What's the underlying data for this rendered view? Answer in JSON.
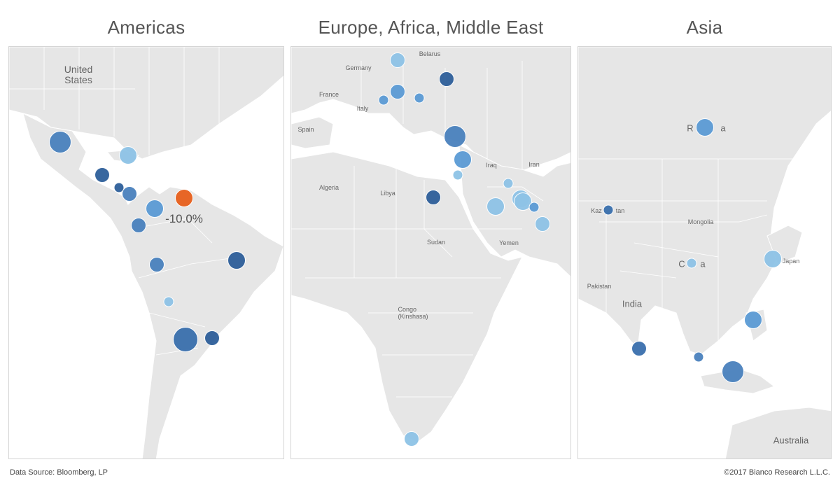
{
  "panels": [
    {
      "id": "americas",
      "title": "Americas",
      "labels": [
        {
          "text": "United\nStates",
          "style": "big"
        }
      ],
      "bubbles": [
        {
          "color": "#4a81bd",
          "size": "large"
        },
        {
          "color": "#8ec3e6",
          "size": "medium"
        },
        {
          "color": "#2e5f9a",
          "size": "small"
        },
        {
          "color": "#2e5f9a",
          "size": "tiny"
        },
        {
          "color": "#4a81bd",
          "size": "small"
        },
        {
          "color": "#e8601c",
          "size": "medium",
          "value_label": "-10.0%"
        },
        {
          "color": "#5b9bd5",
          "size": "medium"
        },
        {
          "color": "#4a81bd",
          "size": "small"
        },
        {
          "color": "#2e5f9a",
          "size": "medium"
        },
        {
          "color": "#4a81bd",
          "size": "small"
        },
        {
          "color": "#8ec3e6",
          "size": "tiny"
        },
        {
          "color": "#3a6fad",
          "size": "xlarge"
        },
        {
          "color": "#2e5f9a",
          "size": "small"
        }
      ]
    },
    {
      "id": "emea",
      "title": "Europe, Africa, Middle East",
      "labels": [
        {
          "text": "Belarus"
        },
        {
          "text": "Germany"
        },
        {
          "text": "France"
        },
        {
          "text": "Italy"
        },
        {
          "text": "Spain"
        },
        {
          "text": "Algeria"
        },
        {
          "text": "Libya"
        },
        {
          "text": "Iraq"
        },
        {
          "text": "Iran"
        },
        {
          "text": "Sudan"
        },
        {
          "text": "Yemen"
        },
        {
          "text": "Congo\n(Kinshasa)"
        }
      ],
      "bubbles": [
        {
          "color": "#8ec3e6",
          "size": "small"
        },
        {
          "color": "#2e5f9a",
          "size": "small"
        },
        {
          "color": "#5b9bd5",
          "size": "small"
        },
        {
          "color": "#5b9bd5",
          "size": "tiny"
        },
        {
          "color": "#5b9bd5",
          "size": "tiny"
        },
        {
          "color": "#4a81bd",
          "size": "large"
        },
        {
          "color": "#5b9bd5",
          "size": "medium"
        },
        {
          "color": "#8ec3e6",
          "size": "tiny"
        },
        {
          "color": "#2e5f9a",
          "size": "small"
        },
        {
          "color": "#8ec3e6",
          "size": "tiny"
        },
        {
          "color": "#8ec3e6",
          "size": "medium"
        },
        {
          "color": "#8ec3e6",
          "size": "medium"
        },
        {
          "color": "#8ec3e6",
          "size": "medium"
        },
        {
          "color": "#5b9bd5",
          "size": "tiny"
        },
        {
          "color": "#8ec3e6",
          "size": "small"
        },
        {
          "color": "#8ec3e6",
          "size": "small"
        }
      ]
    },
    {
      "id": "asia",
      "title": "Asia",
      "labels": [
        {
          "text": "R",
          "style": "med"
        },
        {
          "text": "a",
          "style": "med"
        },
        {
          "text": "Kaz"
        },
        {
          "text": "tan"
        },
        {
          "text": "Mongolia"
        },
        {
          "text": "C",
          "style": "med"
        },
        {
          "text": "a",
          "style": "med"
        },
        {
          "text": "Japan"
        },
        {
          "text": "Pakistan"
        },
        {
          "text": "India",
          "style": "med"
        },
        {
          "text": "Australia",
          "style": "med"
        }
      ],
      "bubbles": [
        {
          "color": "#5b9bd5",
          "size": "medium"
        },
        {
          "color": "#3a6fad",
          "size": "tiny"
        },
        {
          "color": "#8ec3e6",
          "size": "tiny"
        },
        {
          "color": "#8ec3e6",
          "size": "medium"
        },
        {
          "color": "#5b9bd5",
          "size": "medium"
        },
        {
          "color": "#3a6fad",
          "size": "small"
        },
        {
          "color": "#4a81bd",
          "size": "tiny"
        },
        {
          "color": "#4a81bd",
          "size": "large"
        }
      ]
    }
  ],
  "footer": {
    "source": "Data Source: Bloomberg, LP",
    "copyright": "©2017 Bianco Research L.L.C."
  }
}
